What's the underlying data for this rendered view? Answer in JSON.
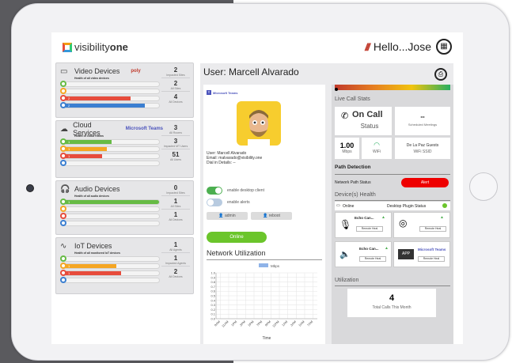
{
  "header": {
    "logo_text_light": "visibility",
    "logo_text_bold": "one",
    "greeting": "Hello...Jose"
  },
  "cards": [
    {
      "title": "Video Devices",
      "brand": "poly",
      "subtitle": "Health of all video devices",
      "bars": [
        {
          "color": "#ffffff",
          "fill": 0.0,
          "label": "",
          "ring": "#66bb44"
        },
        {
          "color": "#ffffff",
          "fill": 0.0,
          "label": "",
          "ring": "#f5a623"
        },
        {
          "color": "#e74c3c",
          "fill": 0.7,
          "label": "2",
          "ring": "#e74c3c"
        },
        {
          "color": "#3b7fd1",
          "fill": 0.85,
          "label": "2",
          "ring": "#3b7fd1"
        }
      ],
      "stats": [
        {
          "value": "2",
          "label": "Impacted Sites"
        },
        {
          "value": "2",
          "label": "All Sites"
        },
        {
          "value": "4",
          "label": "All Devices"
        }
      ]
    },
    {
      "title": "Cloud Services",
      "brand": "Microsoft Teams",
      "subtitle": "Health of cloud rooms",
      "bars": [
        {
          "color": "#66bb44",
          "fill": 0.5,
          "label": "1",
          "ring": "#66bb44"
        },
        {
          "color": "#f5a623",
          "fill": 0.45,
          "label": "1",
          "ring": "#f5a623"
        },
        {
          "color": "#e74c3c",
          "fill": 0.4,
          "label": "1",
          "ring": "#e74c3c"
        },
        {
          "color": "#ffffff",
          "fill": 0.0,
          "label": "",
          "ring": "#3b7fd1"
        }
      ],
      "stats": [
        {
          "value": "3",
          "label": "All Rooms"
        },
        {
          "value": "3",
          "label": "Impacted MT Users"
        },
        {
          "value": "51",
          "label": "All Users"
        }
      ]
    },
    {
      "title": "Audio Devices",
      "brand": "",
      "subtitle": "Health of all audio devices",
      "bars": [
        {
          "color": "#66bb44",
          "fill": 1.0,
          "label": "1",
          "ring": "#66bb44"
        },
        {
          "color": "#ffffff",
          "fill": 0.0,
          "label": "",
          "ring": "#f5a623"
        },
        {
          "color": "#ffffff",
          "fill": 0.0,
          "label": "",
          "ring": "#e74c3c"
        },
        {
          "color": "#ffffff",
          "fill": 0.0,
          "label": "",
          "ring": "#3b7fd1"
        }
      ],
      "stats": [
        {
          "value": "0",
          "label": "Impacted Sites"
        },
        {
          "value": "1",
          "label": "All Sites"
        },
        {
          "value": "1",
          "label": "All Devices"
        }
      ]
    },
    {
      "title": "IoT Devices",
      "brand": "",
      "subtitle": "Health of all monitored IoT devices",
      "bars": [
        {
          "color": "#ffffff",
          "fill": 0.0,
          "label": "",
          "ring": "#66bb44"
        },
        {
          "color": "#f5a623",
          "fill": 0.55,
          "label": "1",
          "ring": "#f5a623"
        },
        {
          "color": "#e74c3c",
          "fill": 0.6,
          "label": "1",
          "ring": "#e74c3c"
        },
        {
          "color": "#ffffff",
          "fill": 0.0,
          "label": "",
          "ring": "#3b7fd1"
        }
      ],
      "stats": [
        {
          "value": "1",
          "label": "All Agents"
        },
        {
          "value": "1",
          "label": "Impacted Agents"
        },
        {
          "value": "2",
          "label": "All Devices"
        }
      ]
    }
  ],
  "user_panel": {
    "title": "User: Marcell Alvarado",
    "teams_label": "Microsoft Teams",
    "user_line": "User: Marcell Alvarado",
    "email_line": "Email: malvarado@visibility.one",
    "dial_line": "Dial in Details: --",
    "toggle_desktop": "enable desktop client",
    "toggle_alerts": "enable alerts",
    "admin_btn": "admin",
    "reboot_btn": "reboot",
    "online_btn": "Online",
    "network_title": "Network Utilization"
  },
  "chart_data": {
    "type": "line",
    "title": "",
    "series": [
      {
        "name": "Mbps",
        "values": []
      }
    ],
    "x": [
      "9AM",
      "11AM",
      "1PM",
      "3PM",
      "5PM",
      "7PM",
      "9PM",
      "11PM",
      "1AM",
      "3AM",
      "5AM",
      "7AM"
    ],
    "xlabel": "Time",
    "ylabel": "",
    "yticks": [
      0.0,
      0.1,
      0.2,
      0.3,
      0.4,
      0.5,
      0.6,
      0.7,
      0.8,
      0.9,
      1.0
    ],
    "ylim": [
      0,
      1.0
    ],
    "grid": true,
    "legend": "top-right"
  },
  "right_panel": {
    "live_title": "Live Call Stats",
    "on_call": "On Call",
    "status": "Status",
    "scheduled_value": "--",
    "scheduled_label": "Scheduled Meetings",
    "mbps_value": "1.00",
    "mbps_label": "Mbps",
    "wifi_label": "WiFi",
    "ssid_value": "De La Paz Guests",
    "ssid_label": "WiFi SSID",
    "path_title": "Path Detection",
    "path_status_label": "Network Path Status",
    "path_status_value": "Alert",
    "health_title": "Device(s) Health",
    "online_label": "Online",
    "plugin_label": "Desktop Plugin Status",
    "dev1_name": "Echo Can...",
    "dev3_name": "Echo Can...",
    "dev4_name": "Microsoft Teams",
    "app_label": "APP",
    "remote_heal": "Remote Heal",
    "utilization_title": "Utilization",
    "calls_value": "4",
    "calls_label": "Total Calls This Month"
  }
}
